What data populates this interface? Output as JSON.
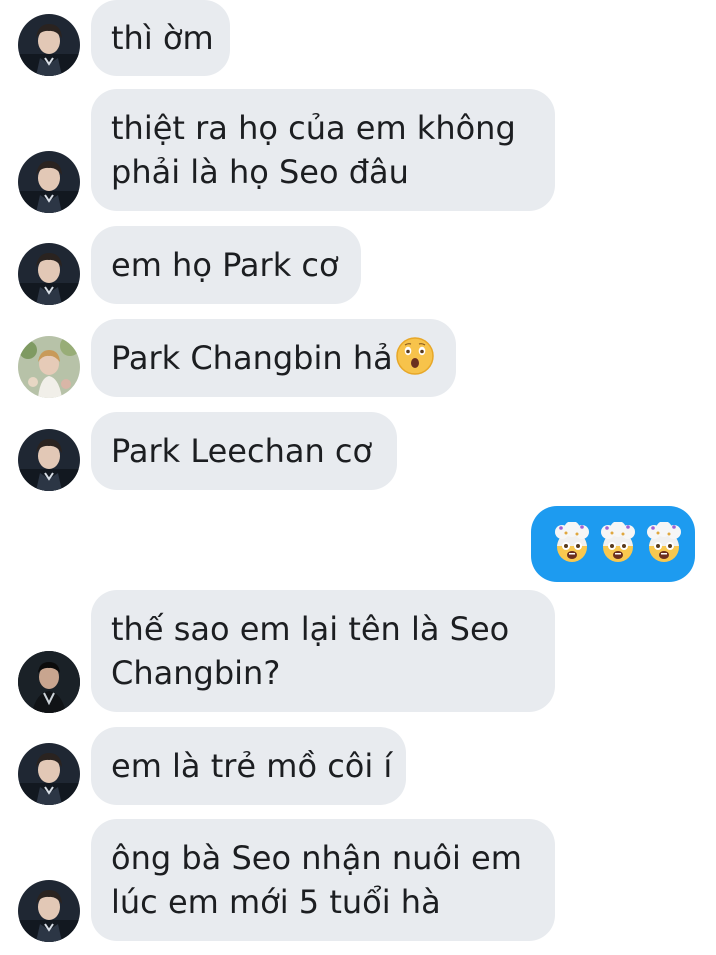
{
  "conversation": {
    "messages": [
      {
        "id": "m1",
        "direction": "incoming",
        "avatar": "avatar-a",
        "text": "thì ờm"
      },
      {
        "id": "m2",
        "direction": "incoming",
        "avatar": "avatar-a",
        "lines": [
          "thiệt ra họ của em không",
          "phải là họ Seo đâu"
        ]
      },
      {
        "id": "m3",
        "direction": "incoming",
        "avatar": "avatar-a",
        "text": "em họ Park cơ"
      },
      {
        "id": "m4",
        "direction": "incoming",
        "avatar": "avatar-b",
        "text": "Park Changbin hả",
        "emoji": "astonished-face-emoji"
      },
      {
        "id": "m5",
        "direction": "incoming",
        "avatar": "avatar-a",
        "text": "Park Leechan cơ"
      },
      {
        "id": "m6",
        "direction": "outgoing",
        "emojis": [
          "exploding-head-emoji",
          "exploding-head-emoji",
          "exploding-head-emoji"
        ]
      },
      {
        "id": "m7",
        "direction": "incoming",
        "avatar": "avatar-c",
        "lines": [
          "thế sao em lại tên là Seo",
          "Changbin?"
        ]
      },
      {
        "id": "m8",
        "direction": "incoming",
        "avatar": "avatar-a",
        "text": "em là trẻ mồ côi í"
      },
      {
        "id": "m9",
        "direction": "incoming",
        "avatar": "avatar-a",
        "lines": [
          "ông bà Seo nhận nuôi em",
          "lúc em mới 5 tuổi hà"
        ]
      }
    ]
  },
  "colors": {
    "incoming_bubble": "#e8ebef",
    "outgoing_bubble": "#1d9bf0",
    "text": "#1c1e21"
  }
}
